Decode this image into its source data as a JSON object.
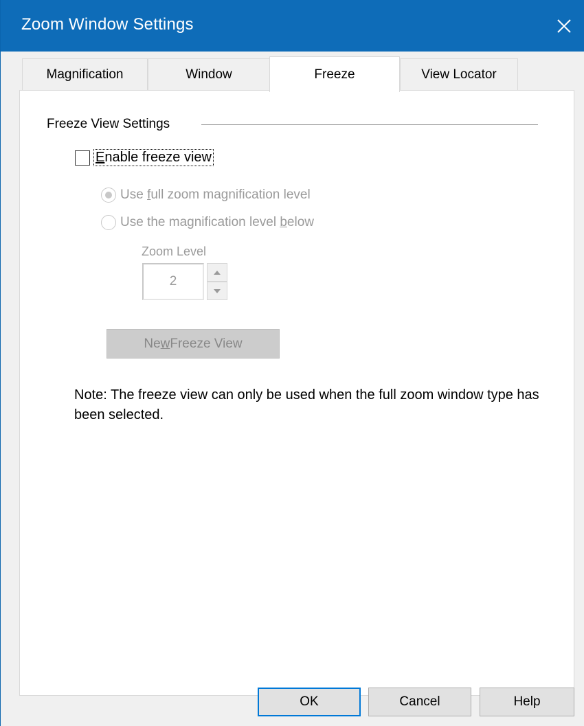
{
  "window": {
    "title": "Zoom Window Settings",
    "accent_color": "#0e6cb8",
    "close_icon": "close-icon"
  },
  "tabs": [
    {
      "label": "Magnification",
      "active": false
    },
    {
      "label": "Window",
      "active": false
    },
    {
      "label": "Freeze",
      "active": true
    },
    {
      "label": "View Locator",
      "active": false
    }
  ],
  "freeze": {
    "group_title": "Freeze View Settings",
    "enable_checkbox": {
      "label": "Enable freeze view",
      "checked": false,
      "mnemonic": "E"
    },
    "radio_full": {
      "prefix": "Use ",
      "mnemonic": "f",
      "suffix": "ull zoom magnification level",
      "selected": true,
      "enabled": false
    },
    "radio_below": {
      "prefix": "Use the magnification level ",
      "mnemonic": "b",
      "suffix": "elow",
      "selected": false,
      "enabled": false
    },
    "zoom_level_label": "Zoom Level",
    "zoom_level_value": "2",
    "new_freeze_button": {
      "prefix": "Ne",
      "mnemonic": "w",
      "suffix": " Freeze View",
      "enabled": false
    },
    "note": "Note: The freeze view can only be used when the full zoom window type has been selected."
  },
  "footer": {
    "ok_label": "OK",
    "cancel_label": "Cancel",
    "help_label": "Help"
  }
}
